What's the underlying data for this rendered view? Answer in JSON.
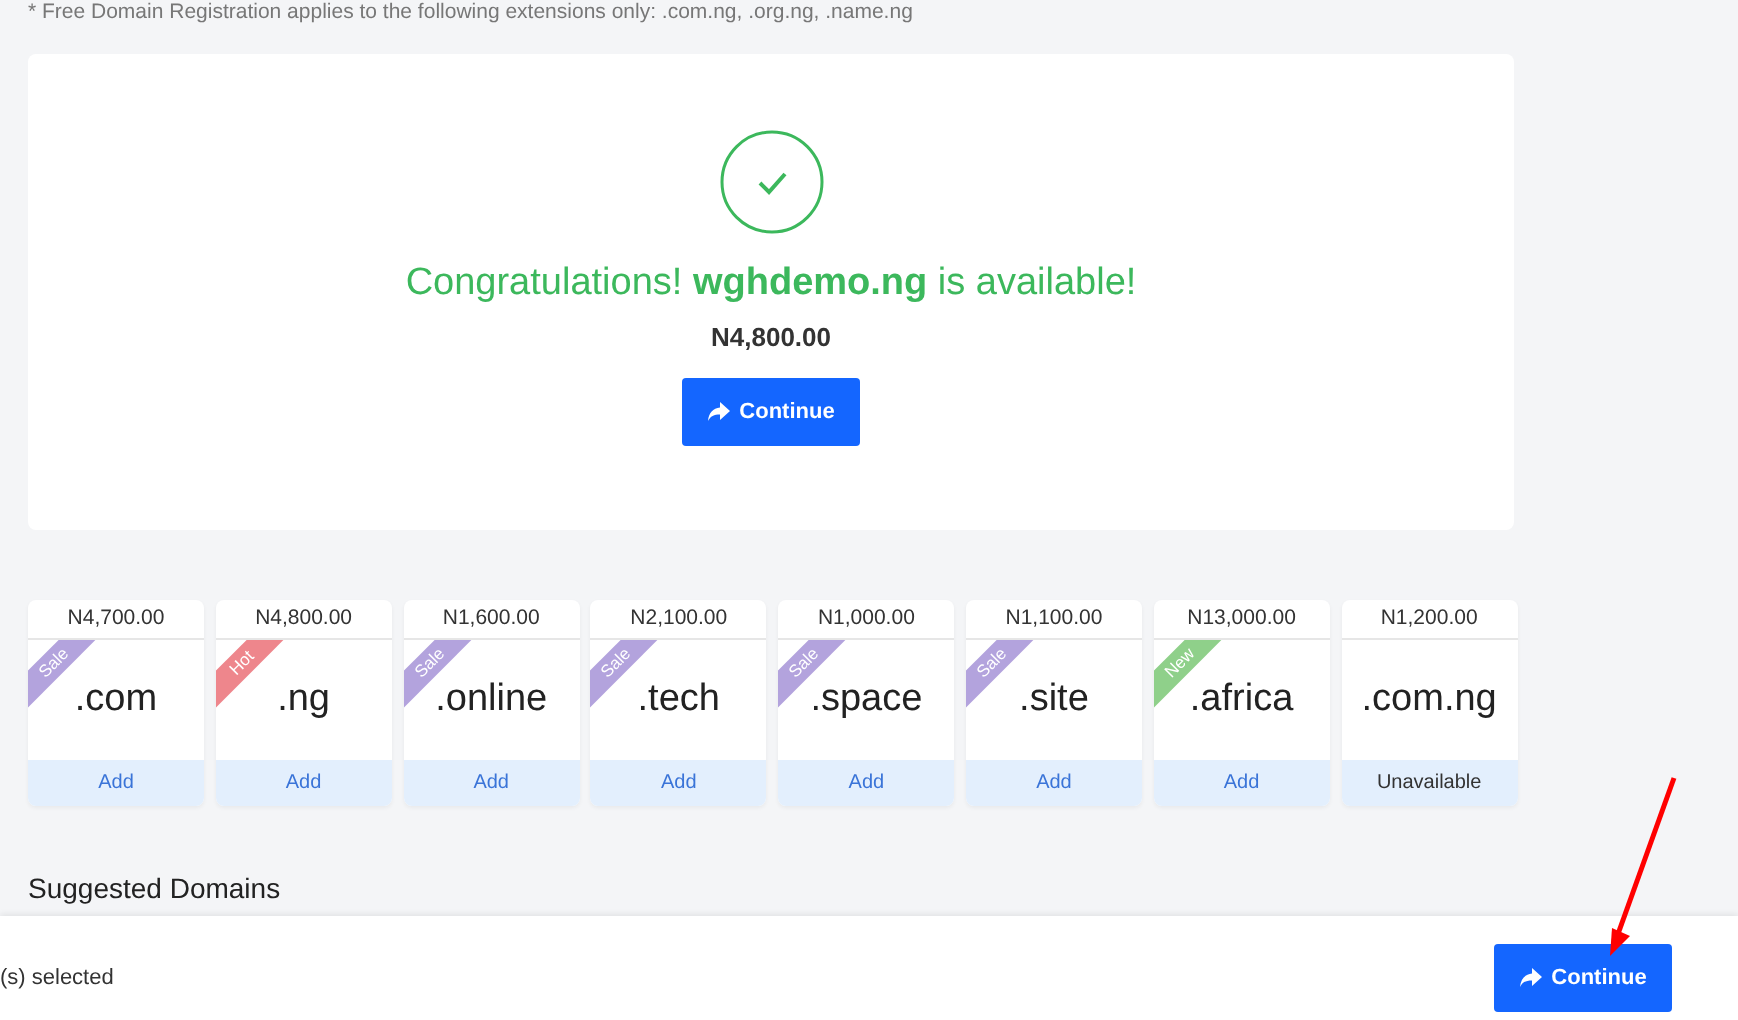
{
  "note": "* Free Domain Registration applies to the following extensions only: .com.ng, .org.ng, .name.ng",
  "result": {
    "prefix": "Congratulations!",
    "domain": "wghdemo.ng",
    "suffix": "is available!",
    "price": "N4,800.00",
    "button": "Continue"
  },
  "tlds": [
    {
      "price": "N4,700.00",
      "tld": ".com",
      "ribbon": "Sale",
      "color": "#b3a3dd",
      "action": "Add",
      "available": true
    },
    {
      "price": "N4,800.00",
      "tld": ".ng",
      "ribbon": "Hot",
      "color": "#ee868c",
      "action": "Add",
      "available": true
    },
    {
      "price": "N1,600.00",
      "tld": ".online",
      "ribbon": "Sale",
      "color": "#b3a3dd",
      "action": "Add",
      "available": true
    },
    {
      "price": "N2,100.00",
      "tld": ".tech",
      "ribbon": "Sale",
      "color": "#b3a3dd",
      "action": "Add",
      "available": true
    },
    {
      "price": "N1,000.00",
      "tld": ".space",
      "ribbon": "Sale",
      "color": "#b3a3dd",
      "action": "Add",
      "available": true
    },
    {
      "price": "N1,100.00",
      "tld": ".site",
      "ribbon": "Sale",
      "color": "#b3a3dd",
      "action": "Add",
      "available": true
    },
    {
      "price": "N13,000.00",
      "tld": ".africa",
      "ribbon": "New",
      "color": "#8fd08a",
      "action": "Add",
      "available": true
    },
    {
      "price": "N1,200.00",
      "tld": ".com.ng",
      "action": "Unavailable",
      "available": false
    }
  ],
  "suggested_heading": "Suggested Domains",
  "footer": {
    "selected": "(s) selected",
    "button": "Continue"
  }
}
